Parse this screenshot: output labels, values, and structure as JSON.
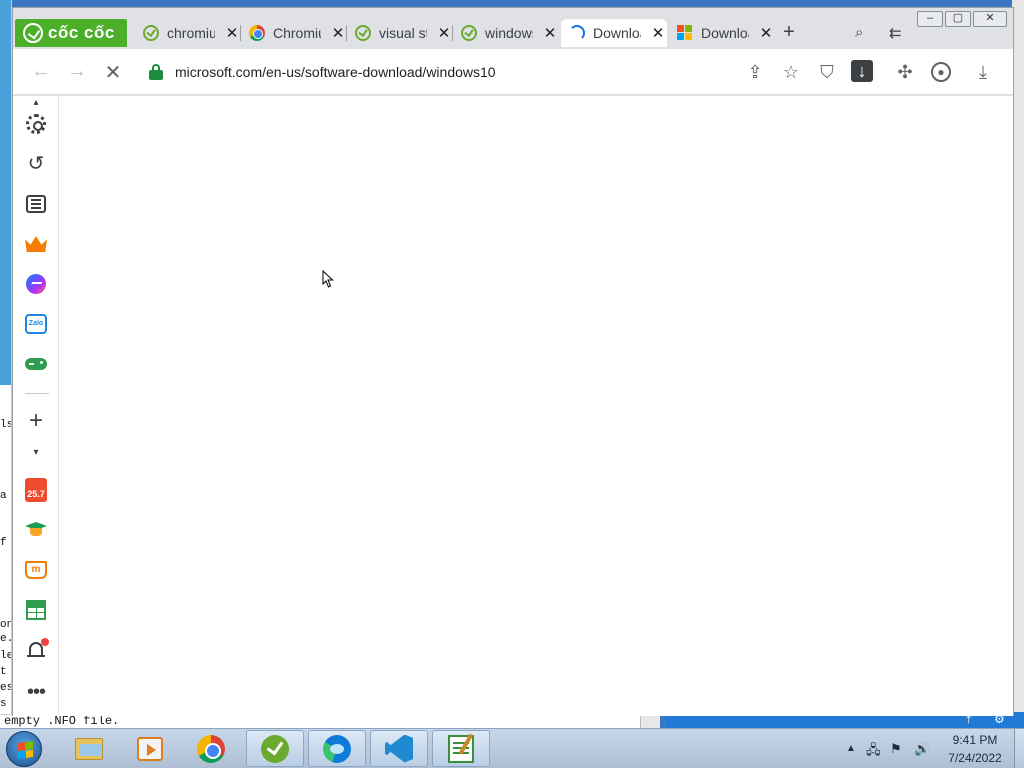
{
  "background": {
    "left_fragments": [
      "ls",
      "a",
      "f",
      "on",
      "e.",
      "le",
      "t",
      "es",
      "es",
      "s"
    ],
    "bottom_text": "empty .NFO file."
  },
  "browser": {
    "brand": "cốc cốc",
    "tabs": [
      {
        "title": "chromium",
        "favicon": "coccoc-icon",
        "active": false
      },
      {
        "title": "Chromium",
        "favicon": "chrome-icon",
        "active": false
      },
      {
        "title": "visual studio",
        "favicon": "coccoc-icon",
        "active": false
      },
      {
        "title": "windows",
        "favicon": "coccoc-icon",
        "active": false
      },
      {
        "title": "Download",
        "favicon": "loading-icon",
        "active": true
      },
      {
        "title": "Download",
        "favicon": "microsoft-icon",
        "active": false
      }
    ],
    "new_tab_label": "+",
    "address": "microsoft.com/en-us/software-download/windows10",
    "page_loading": true
  },
  "colors": {
    "brand_green": "#4caf2a",
    "secure_green": "#1e8e3e",
    "windows_blue": "#3a78c4"
  },
  "sidebar": {
    "items": [
      {
        "name": "settings",
        "icon": "gear-icon"
      },
      {
        "name": "history",
        "icon": "history-icon"
      },
      {
        "name": "reading-list",
        "icon": "list-icon"
      },
      {
        "name": "crown",
        "icon": "crown-icon"
      },
      {
        "name": "messenger",
        "icon": "messenger-icon"
      },
      {
        "name": "zalo",
        "icon": "zalo-icon"
      },
      {
        "name": "games",
        "icon": "gamepad-icon"
      },
      {
        "name": "add",
        "icon": "plus-icon"
      },
      {
        "name": "shopee",
        "icon": "shopee-icon"
      },
      {
        "name": "education",
        "icon": "graduation-icon"
      },
      {
        "name": "shopping",
        "icon": "cart-icon"
      },
      {
        "name": "sheets",
        "icon": "sheet-icon"
      },
      {
        "name": "notifications",
        "icon": "bell-icon"
      },
      {
        "name": "more",
        "icon": "more-icon"
      }
    ],
    "zalo_text": "Zalo",
    "shopee_text": "25.7",
    "cart_text": "m"
  },
  "taskbar": {
    "apps": [
      "Windows Explorer",
      "Media Player",
      "Google Chrome",
      "Cốc Cốc",
      "Microsoft Edge",
      "Visual Studio Code",
      "Notepad++"
    ],
    "time": "9:41 PM",
    "date": "7/24/2022"
  }
}
